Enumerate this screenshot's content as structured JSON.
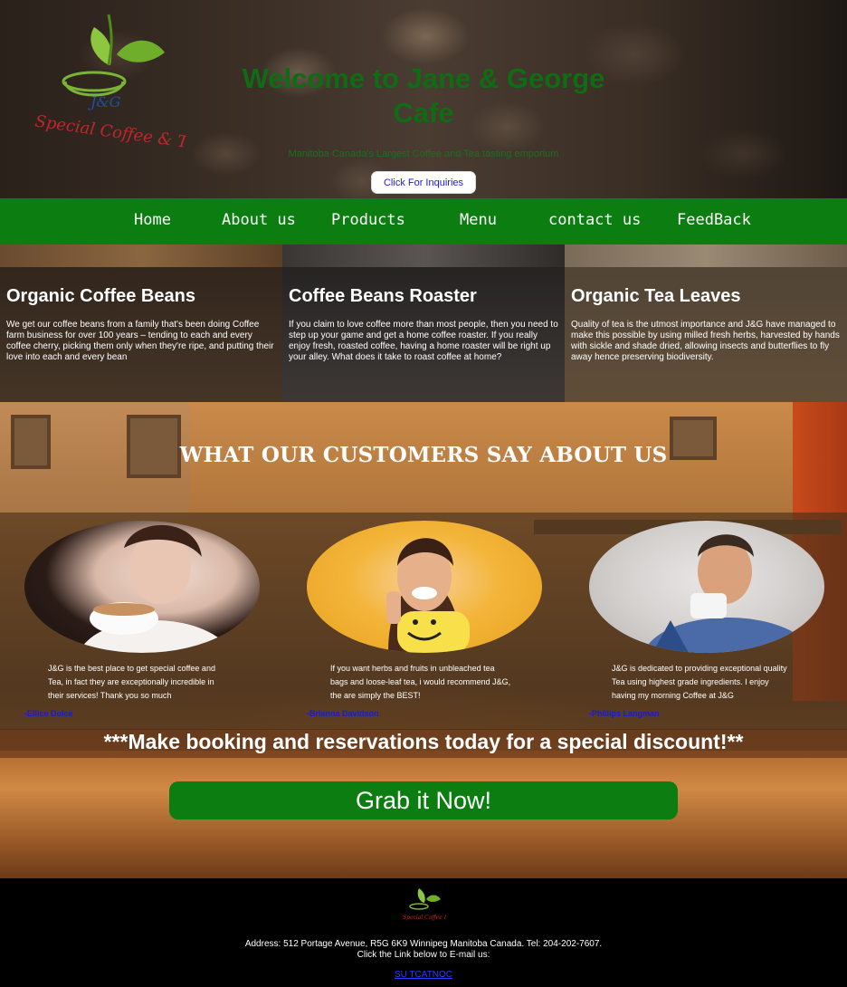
{
  "hero": {
    "title": "Welcome to Jane & George Cafe",
    "subtitle": "Manitoba Canada's Largest Coffee and Tea tasting emporium",
    "inquiry_button": "Click For Inquiries",
    "logo_icon": "leaf-cup-logo-icon"
  },
  "nav": {
    "items": [
      {
        "label": "Home"
      },
      {
        "label": "About us"
      },
      {
        "label": "Products"
      },
      {
        "label": "Menu"
      },
      {
        "label": "contact us"
      },
      {
        "label": "FeedBack"
      }
    ]
  },
  "features": [
    {
      "title": "Organic Coffee Beans",
      "text": "We get our coffee beans from a family that's been doing Coffee farm business for over 100 years – tending to each and every coffee cherry, picking them only when they're ripe, and putting their love into each and every bean"
    },
    {
      "title": "Coffee Beans Roaster",
      "text": "If you claim to love coffee more than most people, then you need to step up your game and get a home coffee roaster. If you really enjoy fresh, roasted coffee, having a home roaster will be right up your alley. What does it take to roast coffee at home?"
    },
    {
      "title": "Organic Tea Leaves",
      "text": "Quality of tea is the utmost importance and J&G have managed to make this possible by using milled fresh herbs, harvested by hands with sickle and shade dried, allowing insects and butterflies to fly away hence preserving biodiversity."
    }
  ],
  "testimonials": {
    "heading": "WHAT OUR CUSTOMERS SAY ABOUT US",
    "items": [
      {
        "text": "J&G is the best place to get special coffee and Tea, in fact they are exceptionally incredible in their services! Thank you so much",
        "author": "-Ellice Dolce"
      },
      {
        "text": "If you want herbs and fruits in unbleached tea bags and loose-leaf tea, i would recommend J&G, the are simply the BEST!",
        "author": "-Brianna Davidson"
      },
      {
        "text": "J&G is dedicated to providing exceptional quality Tea using highest grade ingredients. I enjoy having my morning Coffee at J&G",
        "author": "-Phillips Langman"
      }
    ]
  },
  "promo": {
    "text": "***Make booking and reservations today for a special discount!**",
    "button": "Grab it Now!"
  },
  "footer": {
    "address": "Address: 512 Portage Avenue, R5G 6K9 Winnipeg Manitoba Canada. Tel: 204-202-7607.",
    "email_prompt": "Click the Link below to E-mail us:",
    "link": "SU TCATNOC"
  },
  "colors": {
    "brand_green": "#0c7d10",
    "title_green": "#0f6b14",
    "link_blue": "#1a1ad6"
  }
}
